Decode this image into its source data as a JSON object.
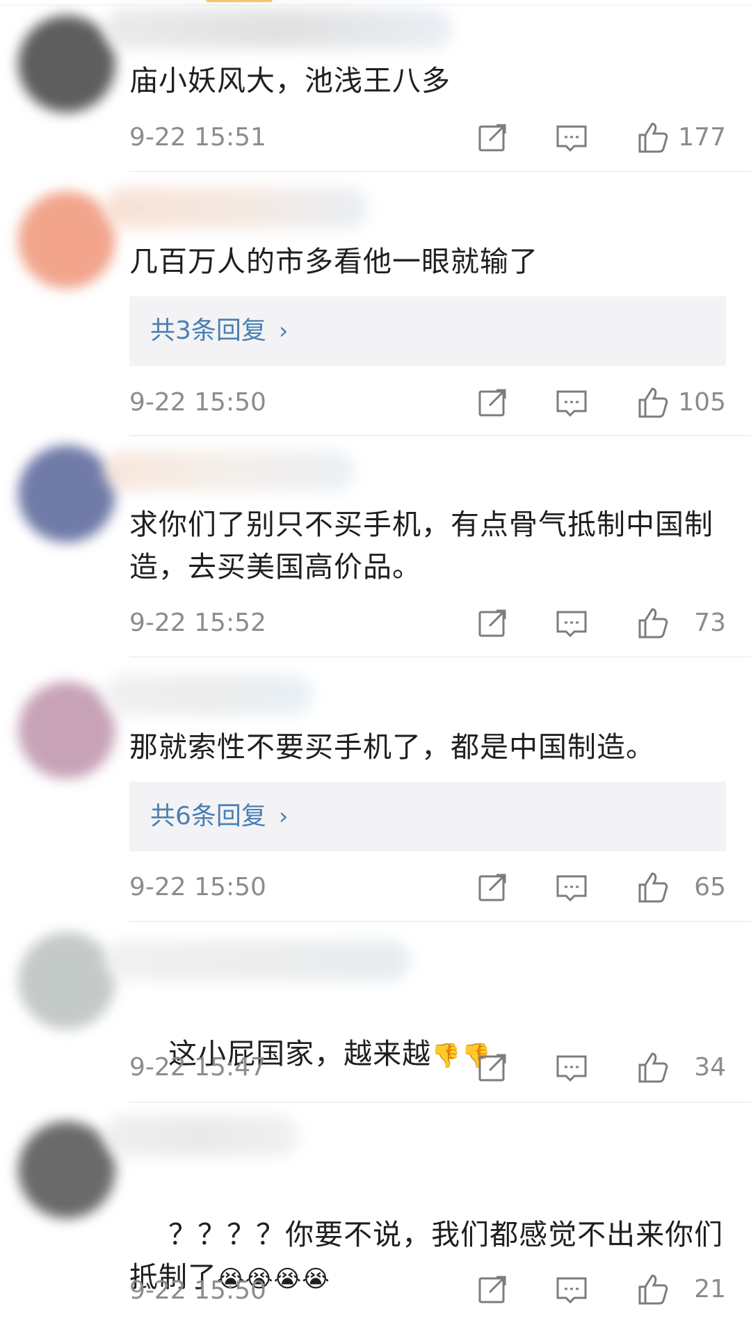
{
  "comments": [
    {
      "text": "庙小妖风大，池浅王八多",
      "time": "9-22 15:51",
      "likes": "177",
      "avatar_color": "#5a5a5a"
    },
    {
      "text": "几百万人的市多看他一眼就输了",
      "replies_label": "共3条回复",
      "time": "9-22 15:50",
      "likes": "105",
      "avatar_color": "#f0a48a"
    },
    {
      "text": "求你们了别只不买手机，有点骨气抵制中国制造，去买美国高价品。",
      "time": "9-22 15:52",
      "likes": "73",
      "avatar_color": "#6f7aa6"
    },
    {
      "text": "那就索性不要买手机了，都是中国制造。",
      "replies_label": "共6条回复",
      "time": "9-22 15:50",
      "likes": "65",
      "avatar_color": "#c9a3b8"
    },
    {
      "text": "这小屁国家，越来越",
      "emoji": "👎👎",
      "time": "9-22 15:47",
      "likes": "34",
      "avatar_color": "#bcc2c0"
    },
    {
      "text": "？？？？你要不说，我们都感觉不出来你们抵制了",
      "emoji": "😭😭😭😭",
      "time": "9-22 15:50",
      "likes": "21",
      "avatar_color": "#6a6a6a"
    }
  ],
  "icons": {
    "share": "share-icon",
    "reply": "comment-icon",
    "like": "thumbs-up-icon",
    "chevron": "chevron-right-icon"
  },
  "colors": {
    "link_blue": "#4a7fb3",
    "meta_gray": "#8c8c8c",
    "reply_bg": "#f3f3f5"
  }
}
